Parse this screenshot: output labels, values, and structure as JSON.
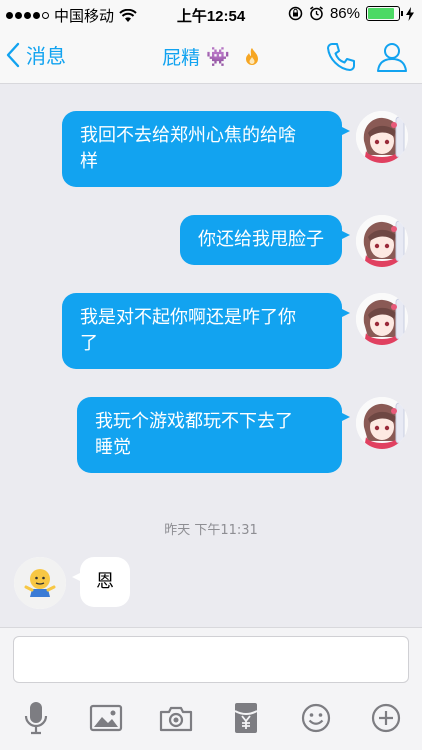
{
  "status_bar": {
    "carrier": "中国移动",
    "time": "上午12:54",
    "battery": "86%",
    "battery_level": 0.86,
    "signal_bars": 4
  },
  "nav": {
    "back_label": "消息",
    "title": "屁精",
    "title_emoji": "👾",
    "accent_color": "#12a3f0"
  },
  "messages": {
    "m1": {
      "line1": "我回不去给郑州心焦的给啥",
      "line2": "样"
    },
    "m2": {
      "line1": "你还给我甩脸子"
    },
    "m3": {
      "line1": "我是对不起你啊还是咋了你",
      "line2": "了"
    },
    "m4": {
      "line1": "我玩个游戏都玩不下去了",
      "line2": "睡觉"
    },
    "timestamp": "昨天 下午11:31",
    "m5": {
      "line1": "恩"
    }
  },
  "input": {
    "value": "",
    "placeholder": ""
  },
  "toolbar": {
    "icons": [
      "mic-icon",
      "image-icon",
      "camera-icon",
      "red-packet-icon",
      "emoji-icon",
      "plus-icon"
    ]
  }
}
